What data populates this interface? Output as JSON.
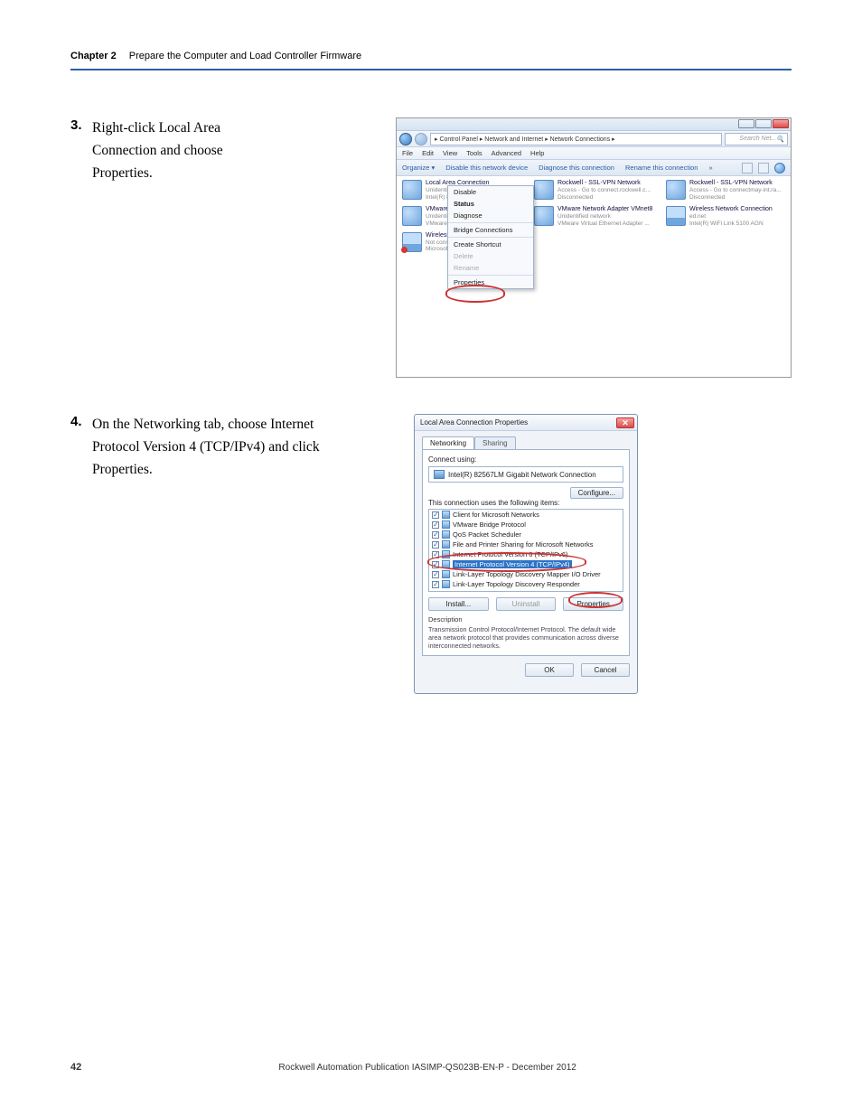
{
  "header": {
    "chapter": "Chapter 2",
    "title": "Prepare the Computer and Load Controller Firmware"
  },
  "steps": {
    "s3": {
      "num": "3.",
      "text": "Right-click Local Area Connection and choose Properties."
    },
    "s4": {
      "num": "4.",
      "text": "On the Networking tab, choose Internet Protocol Version 4 (TCP/IPv4) and click Properties."
    }
  },
  "win1": {
    "breadcrumb": "▸ Control Panel ▸ Network and Internet ▸ Network Connections ▸",
    "search_placeholder": "Search Net...",
    "menu": [
      "File",
      "Edit",
      "View",
      "Tools",
      "Advanced",
      "Help"
    ],
    "toolbar": {
      "organize": "Organize ▾",
      "disable": "Disable this network device",
      "diagnose": "Diagnose this connection",
      "rename": "Rename this connection",
      "more": "»"
    },
    "conns": [
      {
        "name": "Local Area Connection",
        "sub1": "Unidentified network",
        "sub2": "Intel(R) 8..."
      },
      {
        "name": "Rockwell - SSL-VPN Network",
        "sub1": "Access - Go to connect.rockwell.c...",
        "sub2": "Disconnected"
      },
      {
        "name": "Rockwell - SSL-VPN Network",
        "sub1": "Access - Go to connectmay-int.ra...",
        "sub2": "Disconnected"
      },
      {
        "name": "VMware",
        "sub1": "Unidenti",
        "sub2": "VMware"
      },
      {
        "name": "VMware Network Adapter VMnet8",
        "sub1": "Unidentified network",
        "sub2": "VMware Virtual Ethernet Adapter ..."
      },
      {
        "name": "Wireless Network Connection",
        "sub1": "ed.net",
        "sub2": "Intel(R) WiFi Link 5100 AGN"
      },
      {
        "name": "Wireless",
        "sub1": "Not conn",
        "sub2": "Microsof"
      }
    ],
    "ctx": [
      "Disable",
      "Status",
      "Diagnose",
      "Bridge Connections",
      "Create Shortcut",
      "Delete",
      "Rename",
      "Properties"
    ]
  },
  "dlg": {
    "title": "Local Area Connection Properties",
    "tabs": {
      "networking": "Networking",
      "sharing": "Sharing"
    },
    "connect_using": "Connect using:",
    "adapter": "Intel(R) 82567LM Gigabit Network Connection",
    "configure": "Configure...",
    "uses_items": "This connection uses the following items:",
    "items": [
      "Client for Microsoft Networks",
      "VMware Bridge Protocol",
      "QoS Packet Scheduler",
      "File and Printer Sharing for Microsoft Networks",
      "Internet Protocol Version 6 (TCP/IPv6)",
      "Internet Protocol Version 4 (TCP/IPv4)",
      "Link-Layer Topology Discovery Mapper I/O Driver",
      "Link-Layer Topology Discovery Responder"
    ],
    "install": "Install...",
    "uninstall": "Uninstall",
    "properties": "Properties",
    "desc_label": "Description",
    "desc_text": "Transmission Control Protocol/Internet Protocol. The default wide area network protocol that provides communication across diverse interconnected networks.",
    "ok": "OK",
    "cancel": "Cancel"
  },
  "footer": {
    "page": "42",
    "pub": "Rockwell Automation Publication IASIMP-QS023B-EN-P - December 2012"
  }
}
